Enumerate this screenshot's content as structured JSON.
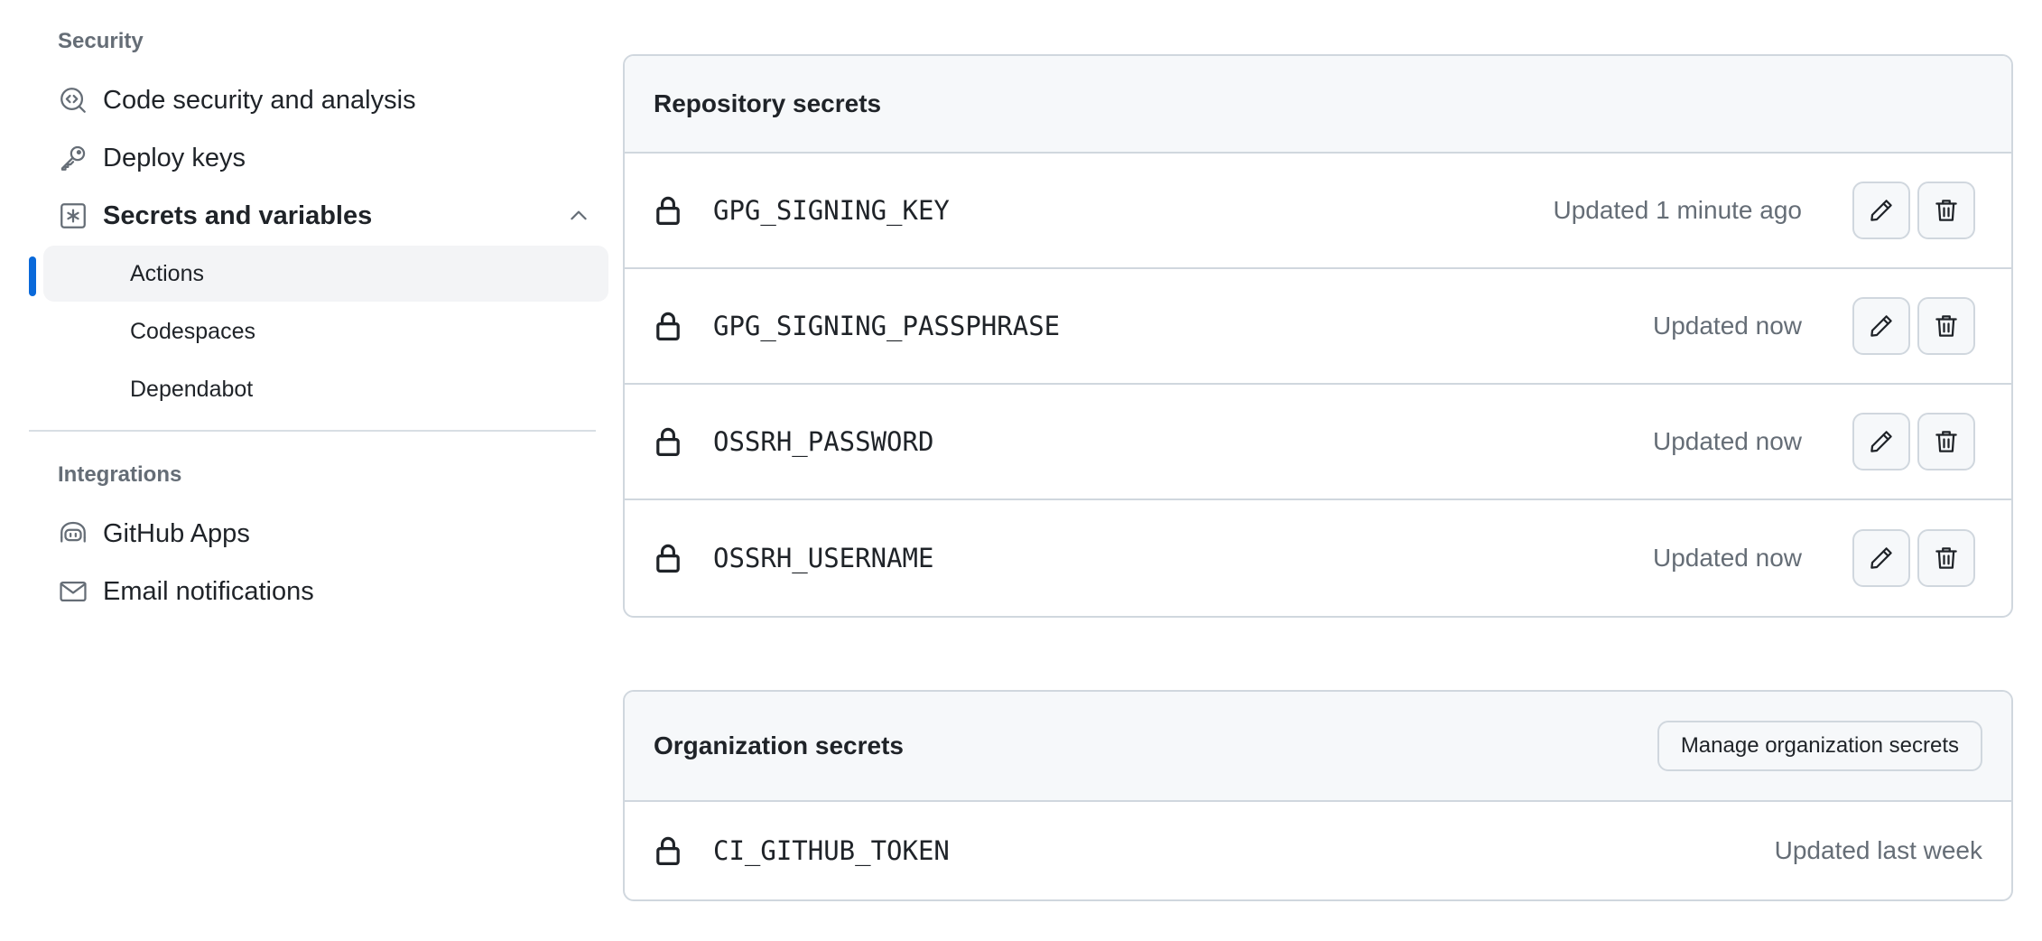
{
  "sidebar": {
    "security_heading": "Security",
    "items": [
      {
        "label": "Code security and analysis",
        "icon": "codescan-icon"
      },
      {
        "label": "Deploy keys",
        "icon": "key-icon"
      },
      {
        "label": "Secrets and variables",
        "icon": "key-asterisk-icon",
        "expanded": true
      }
    ],
    "sub_items": [
      {
        "label": "Actions",
        "active": true
      },
      {
        "label": "Codespaces",
        "active": false
      },
      {
        "label": "Dependabot",
        "active": false
      }
    ],
    "integrations_heading": "Integrations",
    "integration_items": [
      {
        "label": "GitHub Apps",
        "icon": "github-apps-icon"
      },
      {
        "label": "Email notifications",
        "icon": "mail-icon"
      }
    ]
  },
  "repository_secrets": {
    "title": "Repository secrets",
    "rows": [
      {
        "name": "GPG_SIGNING_KEY",
        "updated": "Updated 1 minute ago"
      },
      {
        "name": "GPG_SIGNING_PASSPHRASE",
        "updated": "Updated now"
      },
      {
        "name": "OSSRH_PASSWORD",
        "updated": "Updated now"
      },
      {
        "name": "OSSRH_USERNAME",
        "updated": "Updated now"
      }
    ]
  },
  "organization_secrets": {
    "title": "Organization secrets",
    "manage_label": "Manage organization secrets",
    "rows": [
      {
        "name": "CI_GITHUB_TOKEN",
        "updated": "Updated last week"
      }
    ]
  },
  "colors": {
    "accent": "#0969da",
    "muted_text": "#656d76",
    "border": "#d0d7de",
    "header_bg": "#f6f8fa"
  }
}
